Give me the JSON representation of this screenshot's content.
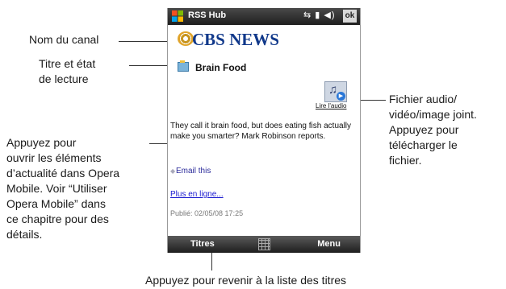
{
  "device": {
    "app_title": "RSS Hub",
    "ok_label": "ok",
    "channel_name": "CBS NEWS",
    "item_title": "Brain Food",
    "audio_link": "Lire l'audio",
    "description": "They call it brain food, but does eating fish actually make you smarter? Mark Robinson reports.",
    "email_label": "Email this",
    "more_link": "Plus en ligne...",
    "published": "Publié: 02/05/08 17:25",
    "softkey_left": "Titres",
    "softkey_right": "Menu"
  },
  "annotations": {
    "channel_name": "Nom du canal",
    "title_state": [
      "Titre et état",
      "de lecture"
    ],
    "open_items": [
      "Appuyez pour",
      "ouvrir les éléments",
      "d’actualité dans Opera",
      "Mobile. Voir “Utiliser",
      "Opera Mobile” dans",
      "ce chapitre pour des",
      "détails."
    ],
    "attachment": [
      "Fichier audio/",
      "vidéo/image joint.",
      "Appuyez pour",
      "télécharger le",
      "fichier."
    ],
    "back_to_titles": "Appuyez pour revenir à la liste des titres"
  },
  "icons": {
    "windows_logo": "windows-logo-icon",
    "status": "status-icons",
    "item": "feed-item-icon",
    "audio": "audio-attachment-icon",
    "keyboard": "keyboard-grid-icon"
  }
}
